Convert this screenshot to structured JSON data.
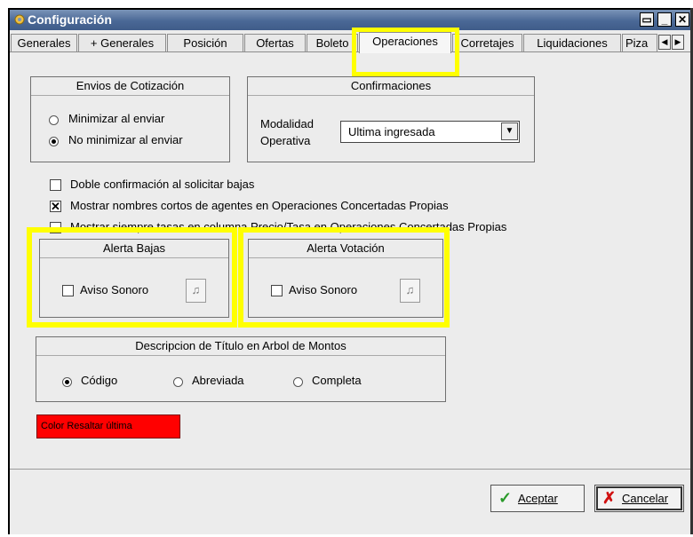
{
  "window": {
    "title": "Configuración"
  },
  "tabs": [
    {
      "label": "Generales"
    },
    {
      "label": "+ Generales"
    },
    {
      "label": "Posición"
    },
    {
      "label": "Ofertas"
    },
    {
      "label": "Boleto"
    },
    {
      "label": "Operaciones"
    },
    {
      "label": "Corretajes"
    },
    {
      "label": "Liquidaciones"
    },
    {
      "label": "Piza"
    }
  ],
  "envios": {
    "title": "Envios de Cotización",
    "opt1": "Minimizar al enviar",
    "opt2": "No minimizar al enviar",
    "selected": "No minimizar al enviar"
  },
  "confirmaciones": {
    "title": "Confirmaciones",
    "label_line1": "Modalidad",
    "label_line2": "Operativa",
    "value": "Ultima ingresada"
  },
  "checks": {
    "doble": "Doble confirmación al solicitar bajas",
    "nombres": "Mostrar nombres cortos de agentes en Operaciones Concertadas Propias",
    "tasas": "Mostrar siempre tasas en columna Precio/Tasa en Operaciones Concertadas Propias"
  },
  "alerta_bajas": {
    "title": "Alerta Bajas",
    "check": "Aviso Sonoro"
  },
  "alerta_votacion": {
    "title": "Alerta Votación",
    "check": "Aviso Sonoro"
  },
  "descripcion": {
    "title": "Descripcion de Título en  Arbol de Montos",
    "opt1": "Código",
    "opt2": "Abreviada",
    "opt3": "Completa",
    "selected": "Código"
  },
  "color_button": {
    "label": "Color Resaltar última",
    "color": "#ff0000"
  },
  "buttons": {
    "accept": "Aceptar",
    "cancel": "Cancelar"
  },
  "highlight_color": "#ffff00"
}
